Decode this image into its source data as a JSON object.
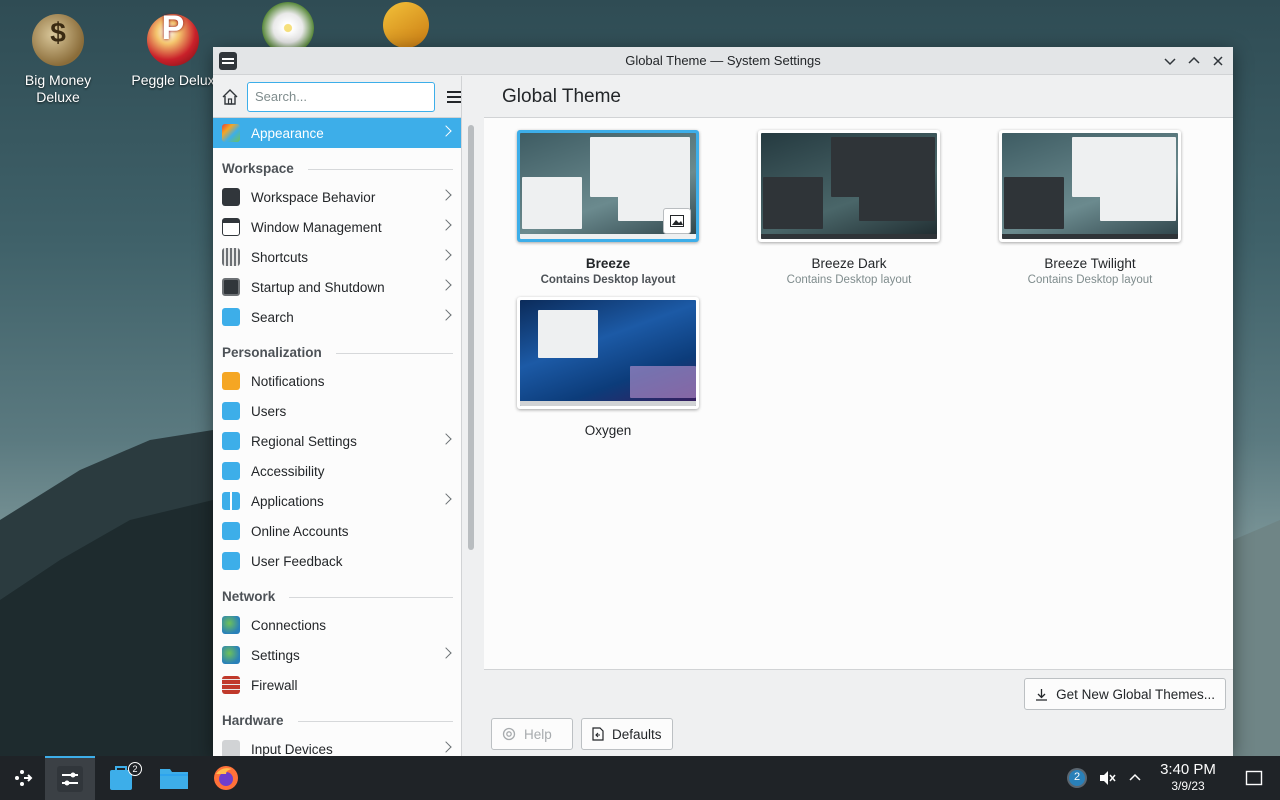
{
  "desktop": {
    "icons": [
      {
        "label": "Big Money\nDeluxe",
        "icon": "money-bag-icon"
      },
      {
        "label": "Peggle Delux",
        "icon": "peggle-icon"
      },
      {
        "label": "",
        "icon": "flower-game-icon"
      },
      {
        "label": "",
        "icon": "gold-block-icon"
      }
    ]
  },
  "window": {
    "title": "Global Theme — System Settings",
    "controls": [
      "minimize",
      "maximize",
      "close"
    ]
  },
  "sidebar": {
    "search_placeholder": "Search...",
    "top_item": {
      "label": "Appearance",
      "active": true
    },
    "sections": [
      {
        "title": "Workspace",
        "items": [
          {
            "label": "Workspace Behavior",
            "chevron": true
          },
          {
            "label": "Window Management",
            "chevron": true
          },
          {
            "label": "Shortcuts",
            "chevron": true
          },
          {
            "label": "Startup and Shutdown",
            "chevron": true
          },
          {
            "label": "Search",
            "chevron": true
          }
        ]
      },
      {
        "title": "Personalization",
        "items": [
          {
            "label": "Notifications",
            "chevron": false
          },
          {
            "label": "Users",
            "chevron": false
          },
          {
            "label": "Regional Settings",
            "chevron": true
          },
          {
            "label": "Accessibility",
            "chevron": false
          },
          {
            "label": "Applications",
            "chevron": true
          },
          {
            "label": "Online Accounts",
            "chevron": false
          },
          {
            "label": "User Feedback",
            "chevron": false
          }
        ]
      },
      {
        "title": "Network",
        "items": [
          {
            "label": "Connections",
            "chevron": false
          },
          {
            "label": "Settings",
            "chevron": true
          },
          {
            "label": "Firewall",
            "chevron": false
          }
        ]
      },
      {
        "title": "Hardware",
        "items": [
          {
            "label": "Input Devices",
            "chevron": true
          }
        ]
      }
    ]
  },
  "main": {
    "title": "Global Theme",
    "themes": [
      {
        "name": "Breeze",
        "subtitle": "Contains Desktop layout",
        "selected": true
      },
      {
        "name": "Breeze Dark",
        "subtitle": "Contains Desktop layout",
        "selected": false
      },
      {
        "name": "Breeze Twilight",
        "subtitle": "Contains Desktop layout",
        "selected": false
      },
      {
        "name": "Oxygen",
        "subtitle": "",
        "selected": false
      }
    ],
    "get_new_label": "Get New Global Themes...",
    "help_label": "Help",
    "defaults_label": "Defaults"
  },
  "taskbar": {
    "time": "3:40 PM",
    "date": "3/9/23",
    "discover_badge": "2",
    "update_badge": "2"
  },
  "colors": {
    "accent": "#3daee9",
    "taskbar": "#1f2327",
    "window_bg": "#eff0f1"
  }
}
